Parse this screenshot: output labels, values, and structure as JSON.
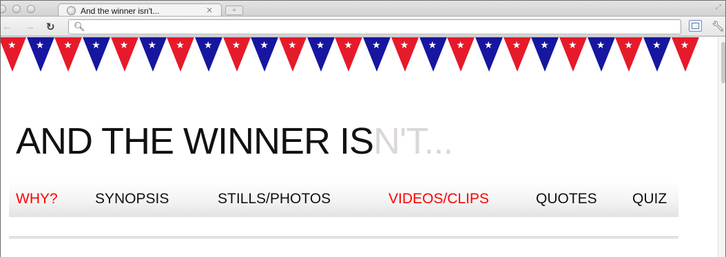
{
  "browser": {
    "tab_title": "And the winner isn't...",
    "tab_close_glyph": "✕",
    "newtab_glyph": "+",
    "address_value": "",
    "icons": [
      "close-window-icon",
      "minimize-icon",
      "zoom-icon",
      "globe-icon",
      "back-arrow-icon",
      "forward-arrow-icon",
      "reload-icon",
      "search-icon",
      "page-action-icon",
      "wrench-icon"
    ]
  },
  "site": {
    "title_main": "AND THE WINNER IS",
    "title_faded": "N'T...",
    "colors": {
      "title": "#111111",
      "title_faded": "#dcd8d8",
      "nav_active": "#ff0000",
      "nav_default": "#111111",
      "pennant_red": "#e61a2a",
      "pennant_blue": "#1616a0"
    }
  },
  "nav": {
    "items": [
      {
        "label": "WHY?",
        "active": true
      },
      {
        "label": "SYNOPSIS",
        "active": false
      },
      {
        "label": "STILLS/PHOTOS",
        "active": false
      },
      {
        "label": "VIDEOS/CLIPS",
        "active": true
      },
      {
        "label": "QUOTES",
        "active": false
      },
      {
        "label": "QUIZ",
        "active": false
      }
    ]
  }
}
